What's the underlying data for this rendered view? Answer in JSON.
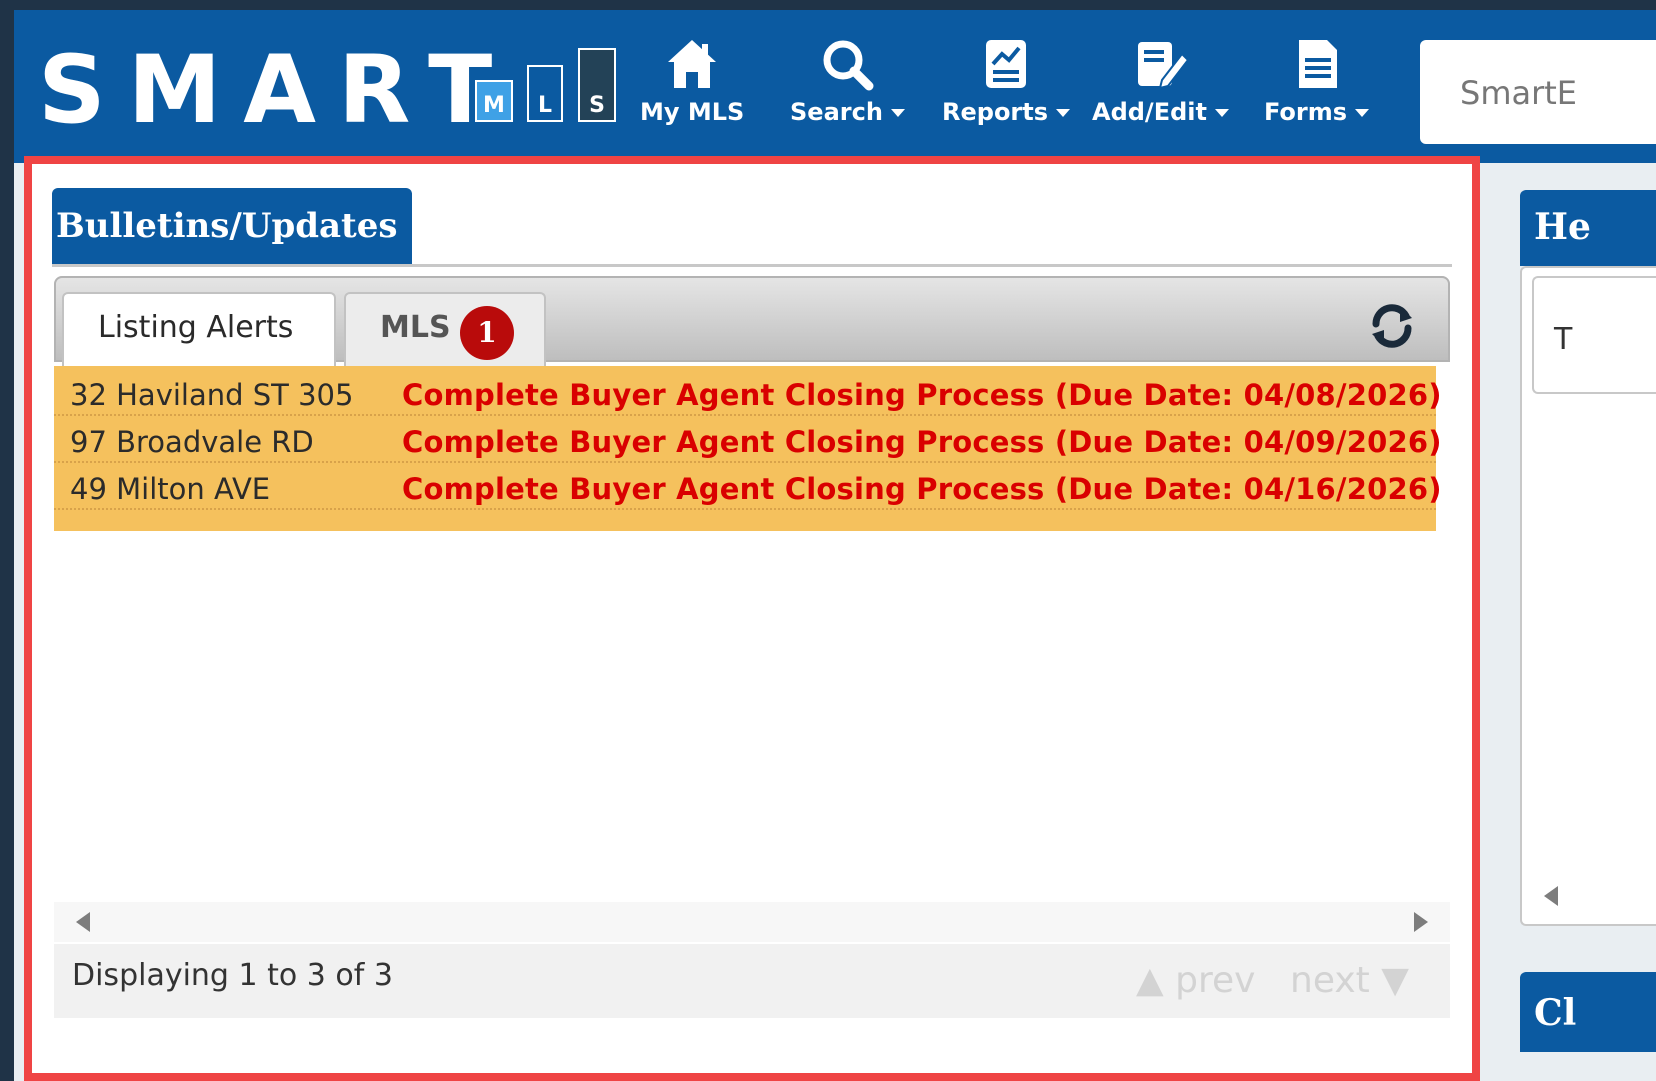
{
  "header": {
    "logo": {
      "word": "SMART",
      "boxes": [
        "M",
        "L",
        "S"
      ]
    },
    "nav": [
      {
        "label": "My MLS",
        "icon": "home-icon",
        "dropdown": false
      },
      {
        "label": "Search",
        "icon": "search-icon",
        "dropdown": true
      },
      {
        "label": "Reports",
        "icon": "reports-icon",
        "dropdown": true
      },
      {
        "label": "Add/Edit",
        "icon": "edit-icon",
        "dropdown": true
      },
      {
        "label": "Forms",
        "icon": "forms-icon",
        "dropdown": true
      }
    ],
    "search_box_text": "SmartE"
  },
  "panel": {
    "title": "Bulletins/Updates",
    "tabs": [
      {
        "label": "Listing Alerts",
        "active": true
      },
      {
        "label": "MLS",
        "active": false,
        "badge": "1"
      }
    ],
    "refresh_icon": "refresh-icon",
    "alerts": [
      {
        "address": "32 Haviland ST 305",
        "task": "Complete Buyer Agent Closing Process (Due Date: 04/08/2026)"
      },
      {
        "address": "97 Broadvale RD",
        "task": "Complete Buyer Agent Closing Process (Due Date: 04/09/2026)"
      },
      {
        "address": "49 Milton AVE",
        "task": "Complete Buyer Agent Closing Process (Due Date: 04/16/2026)"
      }
    ],
    "footer": {
      "display_text": "Displaying 1 to 3 of 3",
      "prev_label": "▲ prev",
      "next_label": "next ▼"
    }
  },
  "right_panel": {
    "top_title": "He",
    "inner_text": "T",
    "bottom_title": "Cl"
  },
  "colors": {
    "header_blue": "#0b5aa1",
    "highlight_red": "#ef4444",
    "alert_background": "#f5c15d",
    "alert_text": "#d90000",
    "badge_red": "#b90b0b"
  }
}
